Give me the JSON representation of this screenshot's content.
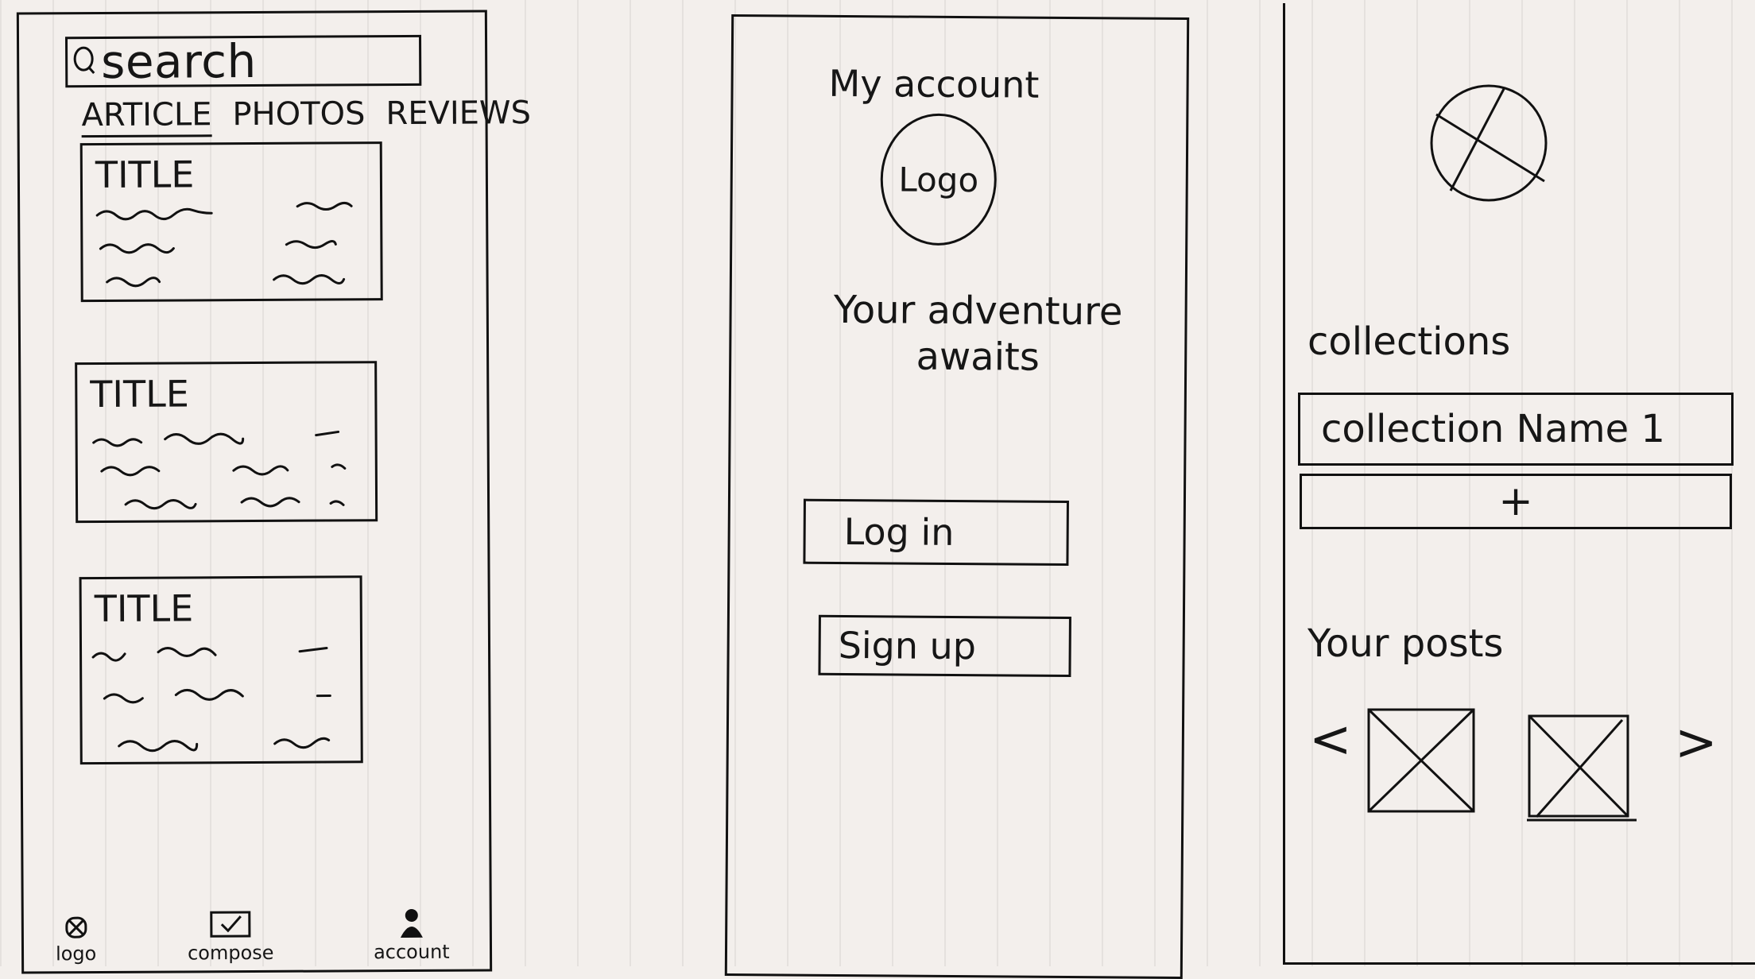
{
  "panel1": {
    "search": {
      "icon": "search-icon",
      "text": "search"
    },
    "tabs": [
      "ARTICLE",
      "PHOTOS",
      "REVIEWS"
    ],
    "active_tab": "ARTICLE",
    "cards": [
      {
        "title": "TITLE"
      },
      {
        "title": "TITLE"
      },
      {
        "title": "TITLE"
      }
    ],
    "bottom_nav": {
      "home": {
        "icon": "logo-placeholder-icon",
        "label": "logo"
      },
      "compose": {
        "icon": "checkbox-icon",
        "label": "compose"
      },
      "account": {
        "icon": "person-icon",
        "label": "account"
      }
    }
  },
  "panel2": {
    "header": "My account",
    "logo_text": "Logo",
    "tagline": "Your adventure awaits",
    "login_label": "Log in",
    "signup_label": "Sign up"
  },
  "panel3": {
    "avatar": {
      "icon": "image-placeholder-icon"
    },
    "collections_label": "collections",
    "collection_items": [
      "collection Name 1"
    ],
    "add_label": "+",
    "posts_label": "Your posts",
    "prev": "<",
    "next": ">"
  }
}
